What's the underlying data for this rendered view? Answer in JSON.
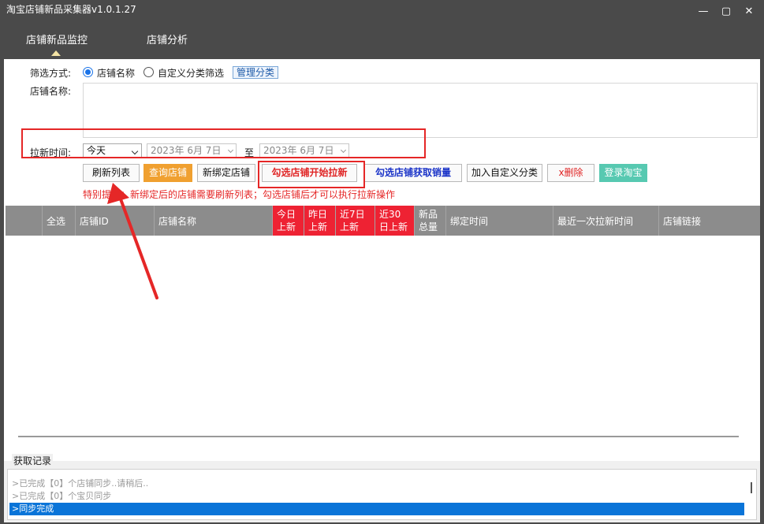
{
  "window": {
    "title": "淘宝店铺新品采集器v1.0.1.27",
    "controls": {
      "minimize": "—",
      "maximize": "▢",
      "close": "✕"
    }
  },
  "tabs": [
    {
      "label": "店铺新品监控",
      "active": true
    },
    {
      "label": "店铺分析",
      "active": false
    }
  ],
  "filter": {
    "label": "筛选方式:",
    "options": [
      {
        "label": "店铺名称",
        "checked": true
      },
      {
        "label": "自定义分类筛选",
        "checked": false
      }
    ],
    "manage_label": "管理分类"
  },
  "shop_name": {
    "label": "店铺名称:",
    "value": ""
  },
  "time": {
    "label": "拉新时间:",
    "preset": "今天",
    "from": "2023年  6月  7日",
    "to_label": "至",
    "to": "2023年  6月  7日"
  },
  "buttons": {
    "refresh": "刷新列表",
    "query": "查询店铺",
    "bind": "新绑定店铺",
    "start_pull": "勾选店铺开始拉新",
    "get_sales": "勾选店铺获取销量",
    "add_category": "加入自定义分类",
    "delete": "x删除",
    "login": "登录淘宝"
  },
  "warning": "特别提示：新绑定后的店铺需要刷新列表；勾选店铺后才可以执行拉新操作",
  "table": {
    "columns": {
      "select_all": "全选",
      "shop_id": "店铺ID",
      "shop_name": "店铺名称",
      "today_1": "今日",
      "today_2": "上新",
      "yesterday_1": "昨日",
      "yesterday_2": "上新",
      "d7_1": "近7日",
      "d7_2": "上新",
      "d30_1": "近30",
      "d30_2": "日上新",
      "total_1": "新品",
      "total_2": "总量",
      "bind_time": "绑定时间",
      "last_pull": "最近一次拉新时间",
      "shop_link": "店铺链接"
    },
    "rows": []
  },
  "log": {
    "title": "获取记录",
    "lines": [
      {
        "text": ">已完成【0】个店铺同步..请稍后..",
        "selected": false
      },
      {
        "text": ">已完成【0】个宝贝同步",
        "selected": false
      },
      {
        "text": ">同步完成",
        "selected": true
      }
    ]
  },
  "colors": {
    "titlebar": "#4a4a4a",
    "highlight": "#e52727",
    "accent_orange": "#f0a030",
    "accent_teal": "#57c9b1",
    "header_gray": "#8c8c8c",
    "header_red": "#ee2233",
    "selection_blue": "#0a74d8"
  }
}
